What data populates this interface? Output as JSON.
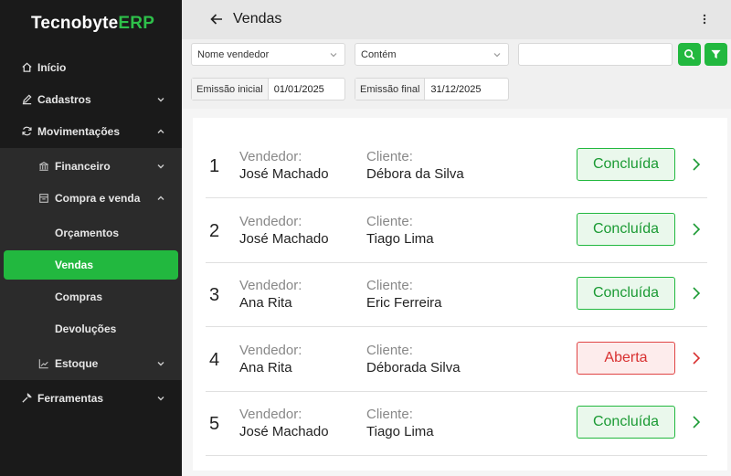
{
  "app": {
    "brand_part1": "Tecnobyte",
    "brand_part2": "ERP"
  },
  "colors": {
    "accent": "#22b83f",
    "sidebar_bg": "#1a1a1a",
    "open_red": "#d83030"
  },
  "sidebar": {
    "inicio": "Início",
    "cadastros": "Cadastros",
    "movimentacoes": "Movimentações",
    "financeiro": "Financeiro",
    "compra_venda": "Compra e venda",
    "orcamentos": "Orçamentos",
    "vendas": "Vendas",
    "compras": "Compras",
    "devolucoes": "Devoluções",
    "estoque": "Estoque",
    "ferramentas": "Ferramentas"
  },
  "header": {
    "title": "Vendas"
  },
  "filters": {
    "field_select": "Nome vendedor",
    "operator_select": "Contém",
    "search_value": "",
    "start_label": "Emissão inicial",
    "start_value": "01/01/2025",
    "end_label": "Emissão final",
    "end_value": "31/12/2025"
  },
  "list": {
    "vendor_label": "Vendedor:",
    "client_label": "Cliente:",
    "rows": [
      {
        "num": "1",
        "vendor": "José Machado",
        "client": "Débora da Silva",
        "status": "Concluída",
        "state": "ok"
      },
      {
        "num": "2",
        "vendor": "José Machado",
        "client": "Tiago Lima",
        "status": "Concluída",
        "state": "ok"
      },
      {
        "num": "3",
        "vendor": "Ana Rita",
        "client": "Eric Ferreira",
        "status": "Concluída",
        "state": "ok"
      },
      {
        "num": "4",
        "vendor": "Ana Rita",
        "client": "Déborada Silva",
        "status": "Aberta",
        "state": "open"
      },
      {
        "num": "5",
        "vendor": "José Machado",
        "client": "Tiago Lima",
        "status": "Concluída",
        "state": "ok"
      }
    ]
  }
}
